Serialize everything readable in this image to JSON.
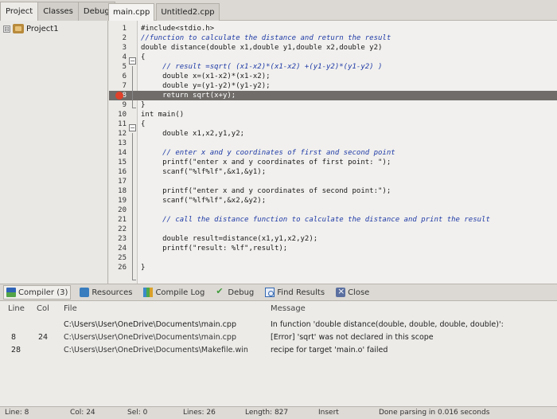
{
  "left_tabs": [
    "Project",
    "Classes",
    "Debug"
  ],
  "file_tabs": [
    "main.cpp",
    "Untitled2.cpp"
  ],
  "project": {
    "expand_glyph": "⊟",
    "name": "Project1"
  },
  "code_lines": [
    {
      "n": "1",
      "text": "#include<stdio.h>"
    },
    {
      "n": "2",
      "text": "//function to calculate the distance and return the result"
    },
    {
      "n": "3",
      "text": "double distance(double x1,double y1,double x2,double y2)"
    },
    {
      "n": "4",
      "text": "{"
    },
    {
      "n": "5",
      "text": "     // result =sqrt( (x1-x2)*(x1-x2) +(y1-y2)*(y1-y2) )"
    },
    {
      "n": "6",
      "text": "     double x=(x1-x2)*(x1-x2);"
    },
    {
      "n": "7",
      "text": "     double y=(y1-y2)*(y1-y2);"
    },
    {
      "n": "8",
      "text": "     return sqrt(x+y);"
    },
    {
      "n": "9",
      "text": "}"
    },
    {
      "n": "10",
      "text": "int main()"
    },
    {
      "n": "11",
      "text": "{"
    },
    {
      "n": "12",
      "text": "     double x1,x2,y1,y2;"
    },
    {
      "n": "13",
      "text": ""
    },
    {
      "n": "14",
      "text": "     // enter x and y coordinates of first and second point"
    },
    {
      "n": "15",
      "text": "     printf(\"enter x and y coordinates of first point: \");"
    },
    {
      "n": "16",
      "text": "     scanf(\"%lf%lf\",&x1,&y1);"
    },
    {
      "n": "17",
      "text": ""
    },
    {
      "n": "18",
      "text": "     printf(\"enter x and y coordinates of second point:\");"
    },
    {
      "n": "19",
      "text": "     scanf(\"%lf%lf\",&x2,&y2);"
    },
    {
      "n": "20",
      "text": ""
    },
    {
      "n": "21",
      "text": "     // call the distance function to calculate the distance and print the result"
    },
    {
      "n": "22",
      "text": ""
    },
    {
      "n": "23",
      "text": "     double result=distance(x1,y1,x2,y2);"
    },
    {
      "n": "24",
      "text": "     printf(\"result: %lf\",result);"
    },
    {
      "n": "25",
      "text": ""
    },
    {
      "n": "26",
      "text": "}"
    }
  ],
  "bottom_tabs": [
    "Compiler (3)",
    "Resources",
    "Compile Log",
    "Debug",
    "Find Results",
    "Close"
  ],
  "messages": {
    "headers": {
      "line": "Line",
      "col": "Col",
      "file": "File",
      "message": "Message"
    },
    "rows": [
      {
        "line": "",
        "col": "",
        "file": "C:\\Users\\User\\OneDrive\\Documents\\main.cpp",
        "message": "In function 'double distance(double, double, double, double)':"
      },
      {
        "line": "8",
        "col": "24",
        "file": "C:\\Users\\User\\OneDrive\\Documents\\main.cpp",
        "message": "[Error] 'sqrt' was not declared in this scope"
      },
      {
        "line": "28",
        "col": "",
        "file": "C:\\Users\\User\\OneDrive\\Documents\\Makefile.win",
        "message": "recipe for target 'main.o' failed"
      }
    ]
  },
  "status": {
    "line_label": "Line:",
    "line_value": "8",
    "col_label": "Col:",
    "col_value": "24",
    "sel_label": "Sel:",
    "sel_value": "0",
    "lines_label": "Lines:",
    "lines_value": "26",
    "length_label": "Length:",
    "length_value": "827",
    "mode": "Insert",
    "message": "Done parsing in 0.016 seconds"
  },
  "colors": {
    "highlight_line": "#6f6c69",
    "comment": "#1f3aa6",
    "error_marker": "#e0412a"
  }
}
